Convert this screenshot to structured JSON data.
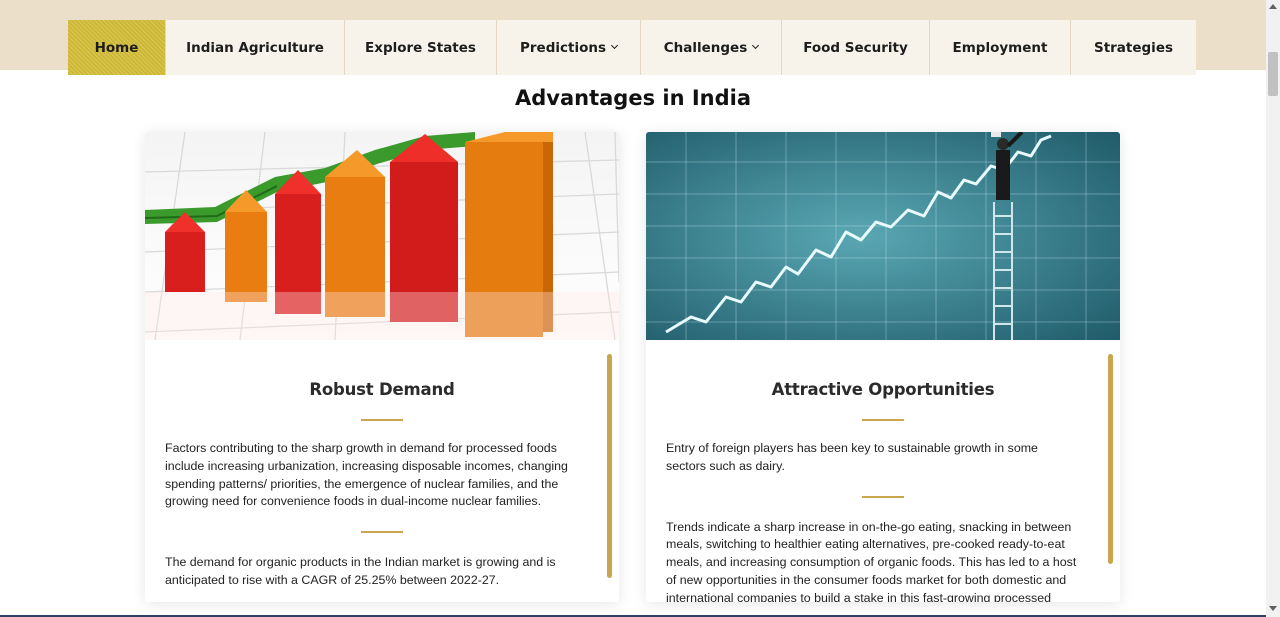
{
  "nav": {
    "items": [
      {
        "label": "Home",
        "active": true,
        "dropdown": false
      },
      {
        "label": "Indian Agriculture",
        "active": false,
        "dropdown": false
      },
      {
        "label": "Explore States",
        "active": false,
        "dropdown": false
      },
      {
        "label": "Predictions",
        "active": false,
        "dropdown": true
      },
      {
        "label": "Challenges",
        "active": false,
        "dropdown": true
      },
      {
        "label": "Food Security",
        "active": false,
        "dropdown": false
      },
      {
        "label": "Employment",
        "active": false,
        "dropdown": false
      },
      {
        "label": "Strategies",
        "active": false,
        "dropdown": false
      }
    ]
  },
  "section": {
    "title": "Advantages in India"
  },
  "cards": [
    {
      "image": "growth-bar-chart-image",
      "title": "Robust Demand",
      "paragraphs": [
        "Factors contributing to the sharp growth in demand for processed foods include increasing urbanization, increasing disposable incomes, changing spending patterns/ priorities, the emergence of nuclear families, and the growing need for convenience foods in dual-income nuclear families.",
        "The demand for organic products in the Indian market is growing and is anticipated to rise with a CAGR of 25.25% between 2022-27."
      ]
    },
    {
      "image": "rising-graph-ladder-image",
      "title": "Attractive Opportunities",
      "paragraphs": [
        "Entry of foreign players has been key to sustainable growth in some sectors such as dairy.",
        "Trends indicate a sharp increase in on-the-go eating, snacking in between meals, switching to healthier eating alternatives, pre-cooked ready-to-eat meals, and increasing consumption of organic foods. This has led to a host of new opportunities in the consumer foods market for both domestic and international companies to build a stake in this fast-growing processed food market."
      ]
    }
  ],
  "colors": {
    "top_band": "#ebdfca",
    "nav_background": "#f7f3ea",
    "nav_active": "#d8c23c",
    "accent_gold": "#c9a54e"
  }
}
